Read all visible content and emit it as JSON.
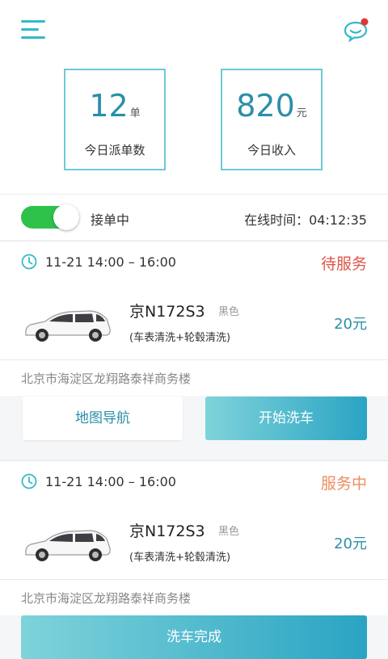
{
  "header": {
    "menu_icon": "menu-icon",
    "chat_icon": "chat-notification-icon",
    "accent": "#34b9c9"
  },
  "stats": [
    {
      "value": "12",
      "unit": "单",
      "label": "今日派单数"
    },
    {
      "value": "820",
      "unit": "元",
      "label": "今日收入"
    }
  ],
  "online": {
    "toggle_on": true,
    "status": "接单中",
    "time": "在线时间：04:12:35"
  },
  "orders": [
    {
      "time": "11-21 14:00 – 16:00",
      "state": "待服务",
      "state_color": "#e05447",
      "plate": "京N172S3",
      "car_color": "黑色",
      "service": "(车表清洗+轮毂清洗)",
      "price": "20元",
      "address": "北京市海淀区龙翔路泰祥商务楼",
      "buttons": {
        "navigate": "地图导航",
        "start": "开始洗车"
      }
    },
    {
      "time": "11-21 14:00 – 16:00",
      "state": "服务中",
      "state_color": "#ef8d5f",
      "plate": "京N172S3",
      "car_color": "黑色",
      "service": "(车表清洗+轮毂清洗)",
      "price": "20元",
      "address": "北京市海淀区龙翔路泰祥商务楼",
      "buttons": {
        "finish": "洗车完成"
      }
    }
  ]
}
